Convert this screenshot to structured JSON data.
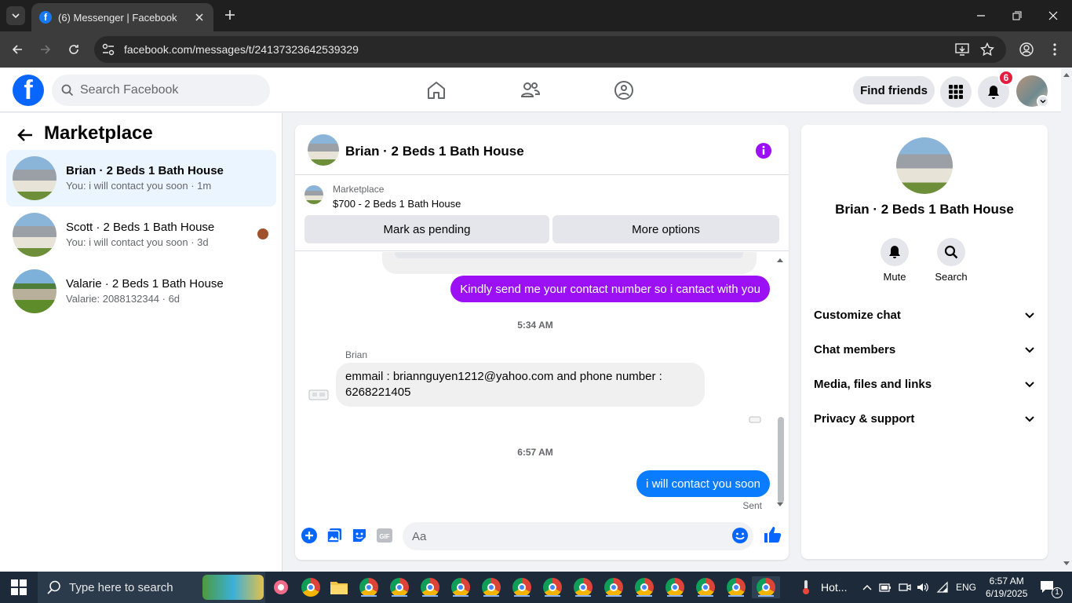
{
  "browser": {
    "tab_title": "(6) Messenger | Facebook",
    "url": "facebook.com/messages/t/24137323642539329"
  },
  "fb_header": {
    "logo_letter": "f",
    "search_placeholder": "Search Facebook",
    "find_friends_label": "Find friends",
    "notification_count": "6"
  },
  "sidebar": {
    "title": "Marketplace",
    "conversations": [
      {
        "name": "Brian · 2 Beds 1 Bath House",
        "preview": "You: i will contact you soon · 1m",
        "active": true
      },
      {
        "name": "Scott · 2 Beds 1 Bath House",
        "preview": "You: i will contact you soon · 3d",
        "active": false
      },
      {
        "name": "Valarie · 2 Beds 1 Bath House",
        "preview": "Valarie: 2088132344 · 6d",
        "active": false
      }
    ]
  },
  "chat": {
    "header_name": "Brian · 2 Beds 1 Bath House",
    "listing_label": "Marketplace",
    "listing_title": "$700 - 2 Beds 1 Bath House",
    "mark_pending_label": "Mark as pending",
    "more_options_label": "More options",
    "messages": {
      "out1": "Kindly send me your contact number so i cantact with you",
      "time1": "5:34 AM",
      "sender": "Brian",
      "in1": "emmail : briannguyen1212@yahoo.com and phone number : 6268221405",
      "time2": "6:57 AM",
      "out2": "i will contact you soon",
      "status": "Sent"
    },
    "composer_placeholder": "Aa"
  },
  "right_panel": {
    "name": "Brian · 2 Beds 1 Bath House",
    "mute_label": "Mute",
    "search_label": "Search",
    "sections": [
      "Customize chat",
      "Chat members",
      "Media, files and links",
      "Privacy & support"
    ]
  },
  "taskbar": {
    "search_placeholder": "Type here to search",
    "weather": "Hot...",
    "language": "ENG",
    "time": "6:57 AM",
    "date": "6/19/2025",
    "notif_count": "1"
  },
  "colors": {
    "fb_blue": "#0866ff",
    "purple_bubble": "#9b10f5",
    "blue_bubble": "#0a7cff",
    "badge_red": "#e41e3f"
  }
}
